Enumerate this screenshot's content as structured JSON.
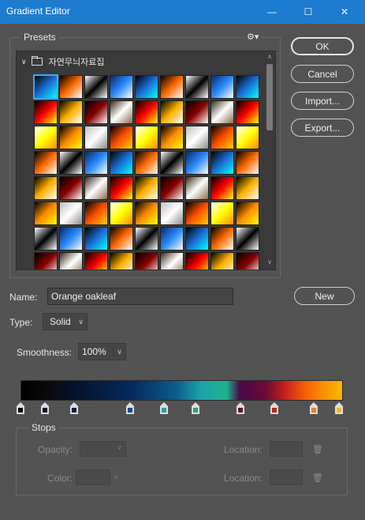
{
  "window": {
    "title": "Gradient Editor",
    "minimize_glyph": "—",
    "maximize_glyph": "☐",
    "close_glyph": "✕"
  },
  "presets": {
    "label": "Presets",
    "gear_glyph": "⚙▾",
    "folder_name": "자연무늬자료집",
    "chevron_glyph": "∨",
    "scroll_up_glyph": "∧",
    "scroll_down_glyph": "∨"
  },
  "buttons": {
    "ok": "OK",
    "cancel": "Cancel",
    "import": "Import...",
    "export": "Export...",
    "new": "New"
  },
  "name": {
    "label": "Name:",
    "value": "Orange oakleaf"
  },
  "type": {
    "label": "Type:",
    "value": "Solid"
  },
  "smoothness": {
    "label": "Smoothness:",
    "value": "100%"
  },
  "stops": {
    "label": "Stops",
    "opacity_label": "Opacity:",
    "color_label": "Color:",
    "location_label": "Location:",
    "delete_glyph": "🗑"
  },
  "gradient_stop_colors": [
    "#000000",
    "#06142e",
    "#0b2150",
    "#0f4c8c",
    "#1aa3a8",
    "#1ea885",
    "#6a0a3a",
    "#c2201a",
    "#fb7b07",
    "#f7b900"
  ]
}
